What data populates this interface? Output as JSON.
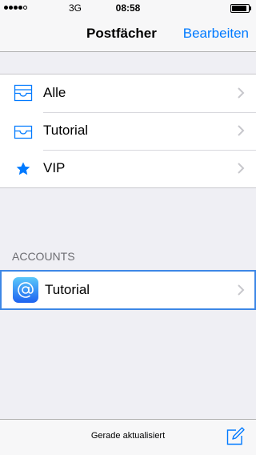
{
  "status_bar": {
    "signal_filled": 4,
    "signal_total": 5,
    "carrier": "3G",
    "time": "08:58",
    "battery_level": 1.0
  },
  "nav": {
    "title": "Postfächer",
    "edit_label": "Bearbeiten"
  },
  "mailboxes": [
    {
      "label": "Alle",
      "icon": "inbox-tray-icon"
    },
    {
      "label": "Tutorial",
      "icon": "inbox-tray-icon"
    },
    {
      "label": "VIP",
      "icon": "star-icon"
    }
  ],
  "accounts": {
    "header": "ACCOUNTS",
    "items": [
      {
        "label": "Tutorial",
        "icon": "at-sign-icon"
      }
    ]
  },
  "toolbar": {
    "status": "Gerade aktualisiert",
    "compose_icon": "compose-icon"
  },
  "colors": {
    "accent": "#007aff",
    "background": "#efeff4",
    "selection_border": "#3d87e6"
  }
}
